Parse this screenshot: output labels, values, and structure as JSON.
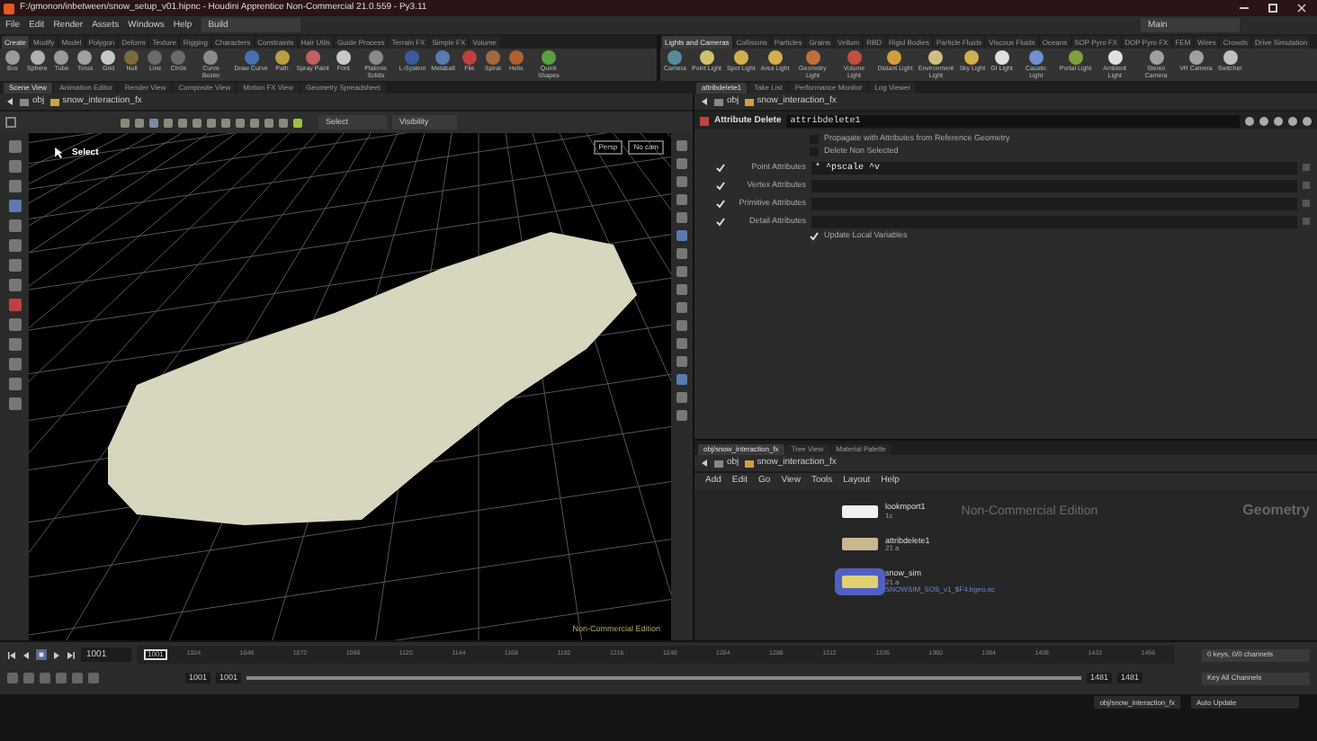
{
  "window": {
    "title": "F:/gmonon/inbetween/snow_setup_v01.hipnc - Houdini Apprentice Non-Commercial 21.0.559 - Py3.11"
  },
  "menu": [
    "File",
    "Edit",
    "Render",
    "Assets",
    "Windows",
    "Help"
  ],
  "desktops": [
    {
      "label": "Build"
    },
    {
      "label": "Main"
    }
  ],
  "shelf_left": {
    "tabs": [
      {
        "label": "Create",
        "selected": true
      },
      {
        "label": "Modify",
        "selected": false
      },
      {
        "label": "Model",
        "selected": false
      },
      {
        "label": "Polygon",
        "selected": false
      },
      {
        "label": "Deform",
        "selected": false
      },
      {
        "label": "Texture",
        "selected": false
      },
      {
        "label": "Rigging",
        "selected": false
      },
      {
        "label": "Characters",
        "selected": false
      },
      {
        "label": "Constraints",
        "selected": false
      },
      {
        "label": "Hair Utils",
        "selected": false
      },
      {
        "label": "Guide Process",
        "selected": false
      },
      {
        "label": "Terrain FX",
        "selected": false
      },
      {
        "label": "Simple FX",
        "selected": false
      },
      {
        "label": "Volume",
        "selected": false
      }
    ],
    "tools": [
      {
        "label": "Box",
        "color": "#9a9a9a"
      },
      {
        "label": "Sphere",
        "color": "#b0b0b0"
      },
      {
        "label": "Tube",
        "color": "#9a9a9a"
      },
      {
        "label": "Torus",
        "color": "#a0a0a0"
      },
      {
        "label": "Grid",
        "color": "#c8c8c8"
      },
      {
        "label": "Null",
        "color": "#7d6a3a"
      },
      {
        "label": "Line",
        "color": "#6a6a6a"
      },
      {
        "label": "Circle",
        "color": "#6a6a6a"
      },
      {
        "label": "Curve Bezier",
        "color": "#8a8a8a"
      },
      {
        "label": "Draw Curve",
        "color": "#4a6fb0"
      },
      {
        "label": "Path",
        "color": "#b8a040"
      },
      {
        "label": "Spray Paint",
        "color": "#c06060"
      },
      {
        "label": "Font",
        "color": "#c8c8c8"
      },
      {
        "label": "Platonic Solids",
        "color": "#8a8a8a"
      },
      {
        "label": "L-System",
        "color": "#3a5a9a"
      },
      {
        "label": "Metaball",
        "color": "#5a7ab0"
      },
      {
        "label": "File",
        "color": "#c04040"
      },
      {
        "label": "Spiral",
        "color": "#a06a40"
      },
      {
        "label": "Helix",
        "color": "#b06030"
      },
      {
        "label": "Quick Shapes",
        "color": "#5aa040"
      }
    ]
  },
  "shelf_right": {
    "tabs": [
      {
        "label": "Lights and Cameras",
        "selected": true
      },
      {
        "label": "Collisions",
        "selected": false
      },
      {
        "label": "Particles",
        "selected": false
      },
      {
        "label": "Grains",
        "selected": false
      },
      {
        "label": "Vellum",
        "selected": false
      },
      {
        "label": "RBD",
        "selected": false
      },
      {
        "label": "Rigid Bodies",
        "selected": false
      },
      {
        "label": "Particle Fluids",
        "selected": false
      },
      {
        "label": "Viscous Fluids",
        "selected": false
      },
      {
        "label": "Oceans",
        "selected": false
      },
      {
        "label": "SOP Pyro FX",
        "selected": false
      },
      {
        "label": "DOP Pyro FX",
        "selected": false
      },
      {
        "label": "FEM",
        "selected": false
      },
      {
        "label": "Wires",
        "selected": false
      },
      {
        "label": "Crowds",
        "selected": false
      },
      {
        "label": "Drive Simulation",
        "selected": false
      }
    ],
    "tools": [
      {
        "label": "Camera",
        "color": "#5a8a9a"
      },
      {
        "label": "Point Light",
        "color": "#d0c070"
      },
      {
        "label": "Spot Light",
        "color": "#d0b050"
      },
      {
        "label": "Area Light",
        "color": "#d0b050"
      },
      {
        "label": "Geometry Light",
        "color": "#c07040"
      },
      {
        "label": "Volume Light",
        "color": "#c05040"
      },
      {
        "label": "Distant Light",
        "color": "#d0a040"
      },
      {
        "label": "Environment Light",
        "color": "#d0c080"
      },
      {
        "label": "Sky Light",
        "color": "#d0b050"
      },
      {
        "label": "GI Light",
        "color": "#e0e0e0"
      },
      {
        "label": "Caustic Light",
        "color": "#7090d0"
      },
      {
        "label": "Portal Light",
        "color": "#80a040"
      },
      {
        "label": "Ambient Light",
        "color": "#e0e0e0"
      },
      {
        "label": "Stereo Camera",
        "color": "#a0a0a0"
      },
      {
        "label": "VR Camera",
        "color": "#a0a0a0"
      },
      {
        "label": "Switcher",
        "color": "#c0c0c0"
      }
    ]
  },
  "scene_tabs": [
    {
      "label": "Scene View",
      "selected": true
    },
    {
      "label": "Animation Editor",
      "selected": false
    },
    {
      "label": "Render View",
      "selected": false
    },
    {
      "label": "Composite View",
      "selected": false
    },
    {
      "label": "Motion FX View",
      "selected": false
    },
    {
      "label": "Geometry Spreadsheet",
      "selected": false
    }
  ],
  "param_tabs": [
    {
      "label": "attribdelete1",
      "selected": true
    },
    {
      "label": "Take List",
      "selected": false
    },
    {
      "label": "Performance Monitor",
      "selected": false
    },
    {
      "label": "Log Viewer",
      "selected": false
    }
  ],
  "viewport": {
    "path": [
      "obj",
      "snow_interaction_fx"
    ],
    "select_menu": "Select",
    "visibility_menu": "Visibility",
    "view_menu": "Persp",
    "camera_menu": "No cam",
    "state": "Select",
    "edition": "Non-Commercial Edition"
  },
  "parameters": {
    "path": [
      "obj",
      "snow_interaction_fx"
    ],
    "node_type": "Attribute Delete",
    "node_name": "attribdelete1",
    "toggles": [
      {
        "label": "Propagate with Attributes from Reference Geometry",
        "checked": false
      },
      {
        "label": "Delete Non Selected",
        "checked": false
      }
    ],
    "fields": [
      {
        "label": "Point Attributes",
        "checked": true,
        "value": "* ^pscale ^v"
      },
      {
        "label": "Vertex Attributes",
        "checked": true
      },
      {
        "label": "Primitive Attributes",
        "checked": true
      },
      {
        "label": "Detail Attributes",
        "checked": true
      }
    ],
    "update": {
      "label": "Update Local Variables",
      "checked": true
    }
  },
  "network": {
    "tabs": [
      {
        "label": "obj/snow_interaction_fx",
        "selected": true
      },
      {
        "label": "Tree View",
        "selected": false
      },
      {
        "label": "Material Palette",
        "selected": false
      }
    ],
    "path": [
      "obj",
      "snow_interaction_fx"
    ],
    "menu": [
      "Add",
      "Edit",
      "Go",
      "View",
      "Tools",
      "Layout",
      "Help"
    ],
    "edition": "Non-Commercial Edition",
    "context": "Geometry",
    "nodes": [
      {
        "kind": "merge",
        "name": "lookmport1",
        "info": "1c"
      },
      {
        "kind": "wrangle",
        "name": "attribdelete1",
        "info": "21 a"
      },
      {
        "kind": "sim",
        "name": "snow_sim",
        "info": "21 a",
        "file": "SNOWSIM_SOS_v1_$F4.bgeo.sc"
      }
    ]
  },
  "timeline": {
    "frame": "1001",
    "marker": "1001",
    "ticks": [
      "1024",
      "1048",
      "1072",
      "1096",
      "1120",
      "1144",
      "1168",
      "1192",
      "1216",
      "1240",
      "1264",
      "1288",
      "1312",
      "1336",
      "1360",
      "1384",
      "1408",
      "1432",
      "1456"
    ],
    "start": "1001",
    "range_slider": {
      "level": 1
    },
    "range_start": "1001",
    "range_end": "1481",
    "end": "1481",
    "keys": "0 keys, 0/0 channels",
    "key_all": "Key All Channels",
    "path": "obj/snow_interaction_fx",
    "update": "Auto Update"
  }
}
